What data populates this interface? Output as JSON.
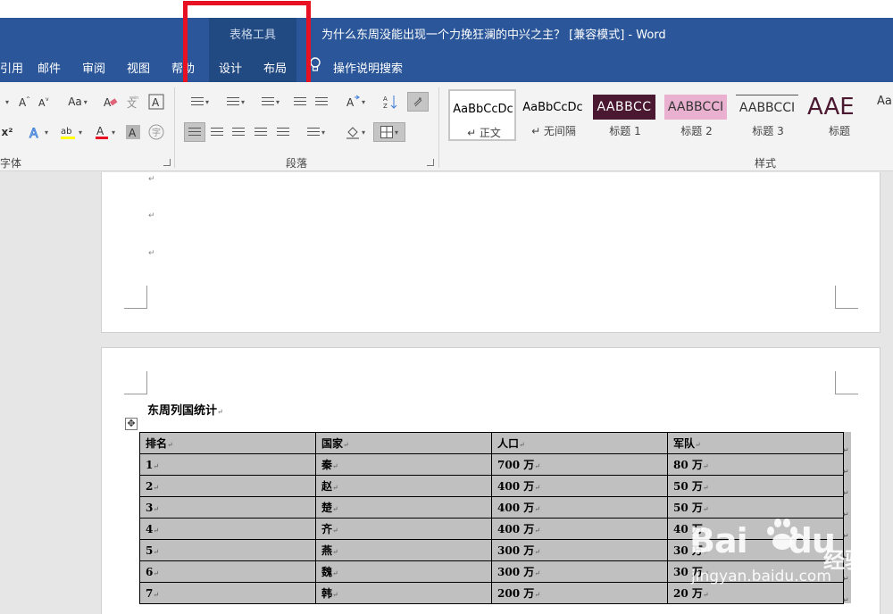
{
  "app": {
    "contextual_group": "表格工具",
    "document_title": "为什么东周没能出现一个力挽狂澜的中兴之主？ [兼容模式]  -  Word"
  },
  "tabs": [
    {
      "label": "引用"
    },
    {
      "label": "邮件"
    },
    {
      "label": "审阅"
    },
    {
      "label": "视图"
    },
    {
      "label": "帮助"
    },
    {
      "label": "设计"
    },
    {
      "label": "布局"
    }
  ],
  "tell_me": "操作说明搜索",
  "ribbon": {
    "groups": {
      "font": "字体",
      "paragraph": "段落",
      "styles": "样式"
    },
    "styles": [
      {
        "preview": "AaBbCcDc",
        "name": "↵ 正文"
      },
      {
        "preview": "AaBbCcDc",
        "name": "↵ 无间隔"
      },
      {
        "preview": "AABBCC",
        "name": "标题 1"
      },
      {
        "preview": "AABBCCI",
        "name": "标题 2"
      },
      {
        "preview": "AABBCCI",
        "name": "标题 3"
      },
      {
        "preview": "AAE",
        "name": "标题"
      }
    ],
    "colors": {
      "title_bar": "#2b579a",
      "contextual": "#224a82",
      "highlight_box": "#e81123",
      "heading1_bg": "#4a1830",
      "heading2_bg": "#e9b1cf",
      "table_shading": "#c0c0c0"
    }
  },
  "document": {
    "heading": "东周列国统计",
    "table": {
      "headers": [
        "排名",
        "国家",
        "人口",
        "军队"
      ],
      "rows": [
        [
          "1",
          "秦",
          "700 万",
          "80 万"
        ],
        [
          "2",
          "赵",
          "400 万",
          "50 万"
        ],
        [
          "3",
          "楚",
          "400 万",
          "50 万"
        ],
        [
          "4",
          "齐",
          "400 万",
          "40 万"
        ],
        [
          "5",
          "燕",
          "300 万",
          "30 万"
        ],
        [
          "6",
          "魏",
          "300 万",
          "30 万"
        ],
        [
          "7",
          "韩",
          "200 万",
          "20 万"
        ]
      ]
    }
  },
  "watermark": {
    "brand": "Bai",
    "brand_suffix": "du",
    "cn": "经验",
    "url": "jingyan.baidu.com"
  }
}
